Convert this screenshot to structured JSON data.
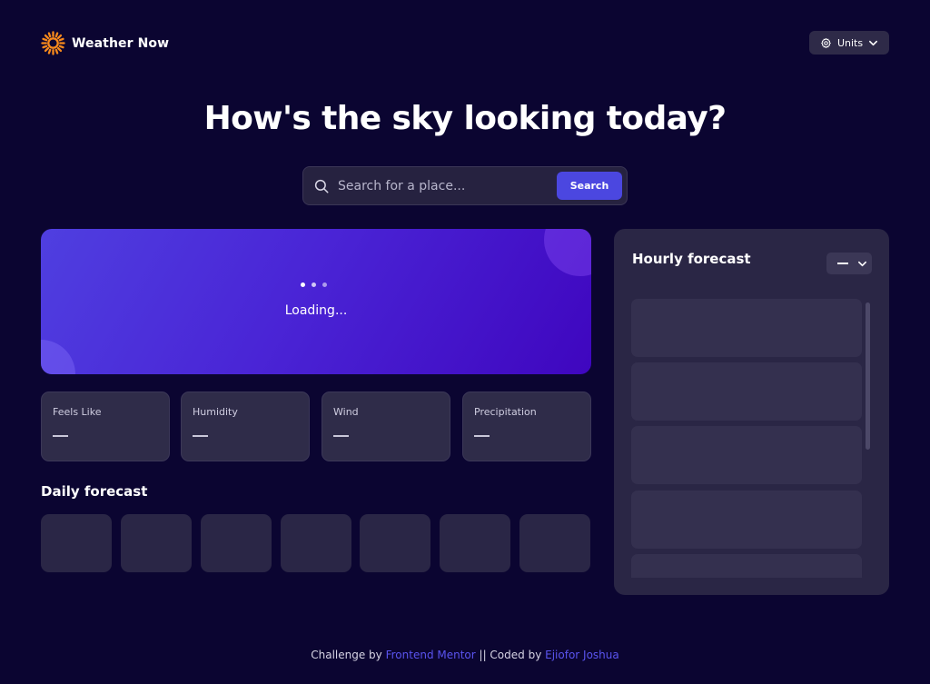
{
  "header": {
    "logo_text": "Weather Now",
    "units_label": "Units",
    "logo_icon": "sun-icon",
    "units_icon": "gear-icon",
    "units_chevron_icon": "chevron-down-icon"
  },
  "hero": {
    "headline": "How's the sky looking today?"
  },
  "search": {
    "placeholder": "Search for a place...",
    "value": "",
    "button_label": "Search",
    "icon": "search-icon"
  },
  "current": {
    "loading_text": "Loading..."
  },
  "stats": [
    {
      "label": "Feels Like",
      "value": "—"
    },
    {
      "label": "Humidity",
      "value": "—"
    },
    {
      "label": "Wind",
      "value": "—"
    },
    {
      "label": "Precipitation",
      "value": "—"
    }
  ],
  "daily": {
    "title": "Daily forecast",
    "placeholder_count": 7
  },
  "hourly": {
    "title": "Hourly forecast",
    "selected_day": "—",
    "placeholder_count": 5
  },
  "footer": {
    "prefix": "Challenge by",
    "link1": "Frontend Mentor",
    "middle": "|| Coded by",
    "link2": "Ejiofor Joshua"
  },
  "colors": {
    "background": "#0b0531",
    "accent": "#4b47e0",
    "card": "#2f2c49",
    "sun": "#f7891c"
  }
}
